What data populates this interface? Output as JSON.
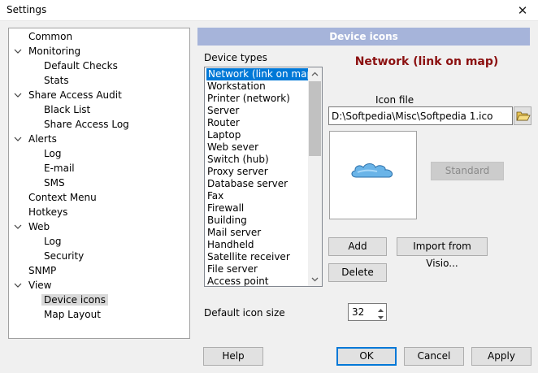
{
  "window": {
    "title": "Settings",
    "close_glyph": "✕"
  },
  "tree": [
    {
      "label": "Common",
      "depth": 0,
      "expander": false,
      "selected": false
    },
    {
      "label": "Monitoring",
      "depth": 0,
      "expander": true,
      "selected": false
    },
    {
      "label": "Default Checks",
      "depth": 1,
      "expander": false,
      "selected": false
    },
    {
      "label": "Stats",
      "depth": 1,
      "expander": false,
      "selected": false
    },
    {
      "label": "Share Access Audit",
      "depth": 0,
      "expander": true,
      "selected": false
    },
    {
      "label": "Black List",
      "depth": 1,
      "expander": false,
      "selected": false
    },
    {
      "label": "Share Access Log",
      "depth": 1,
      "expander": false,
      "selected": false
    },
    {
      "label": "Alerts",
      "depth": 0,
      "expander": true,
      "selected": false
    },
    {
      "label": "Log",
      "depth": 1,
      "expander": false,
      "selected": false
    },
    {
      "label": "E-mail",
      "depth": 1,
      "expander": false,
      "selected": false
    },
    {
      "label": "SMS",
      "depth": 1,
      "expander": false,
      "selected": false
    },
    {
      "label": "Context Menu",
      "depth": 0,
      "expander": false,
      "selected": false
    },
    {
      "label": "Hotkeys",
      "depth": 0,
      "expander": false,
      "selected": false
    },
    {
      "label": "Web",
      "depth": 0,
      "expander": true,
      "selected": false
    },
    {
      "label": "Log",
      "depth": 1,
      "expander": false,
      "selected": false
    },
    {
      "label": "Security",
      "depth": 1,
      "expander": false,
      "selected": false
    },
    {
      "label": "SNMP",
      "depth": 0,
      "expander": false,
      "selected": false
    },
    {
      "label": "View",
      "depth": 0,
      "expander": true,
      "selected": false
    },
    {
      "label": "Device icons",
      "depth": 1,
      "expander": false,
      "selected": true
    },
    {
      "label": "Map Layout",
      "depth": 1,
      "expander": false,
      "selected": false
    }
  ],
  "panel": {
    "header": "Device icons",
    "device_types_label": "Device types",
    "device_title": "Network (link on map)",
    "device_types": [
      "Network (link on map)",
      "Workstation",
      "Printer (network)",
      "Server",
      "Router",
      "Laptop",
      "Web sever",
      "Switch (hub)",
      "Proxy server",
      "Database server",
      "Fax",
      "Firewall",
      "Building",
      "Mail server",
      "Handheld",
      "Satellite receiver",
      "File server",
      "Access point"
    ],
    "selected_index": 0,
    "icon_file_label": "Icon file",
    "icon_file_value": "D:\\Softpedia\\Misc\\Softpedia 1.ico",
    "standard_label": "Standard",
    "add_label": "Add",
    "import_label": "Import from Visio...",
    "delete_label": "Delete",
    "default_icon_size_label": "Default icon size",
    "default_icon_size_value": "32"
  },
  "footer": {
    "help": "Help",
    "ok": "OK",
    "cancel": "Cancel",
    "apply": "Apply"
  },
  "colors": {
    "header_band": "#a6b4da",
    "title_red": "#8b1010",
    "selection": "#0078d7",
    "cloud": "#6ab4e8"
  },
  "icons": {
    "browse": "folder-open-icon",
    "cloud": "cloud-icon"
  }
}
